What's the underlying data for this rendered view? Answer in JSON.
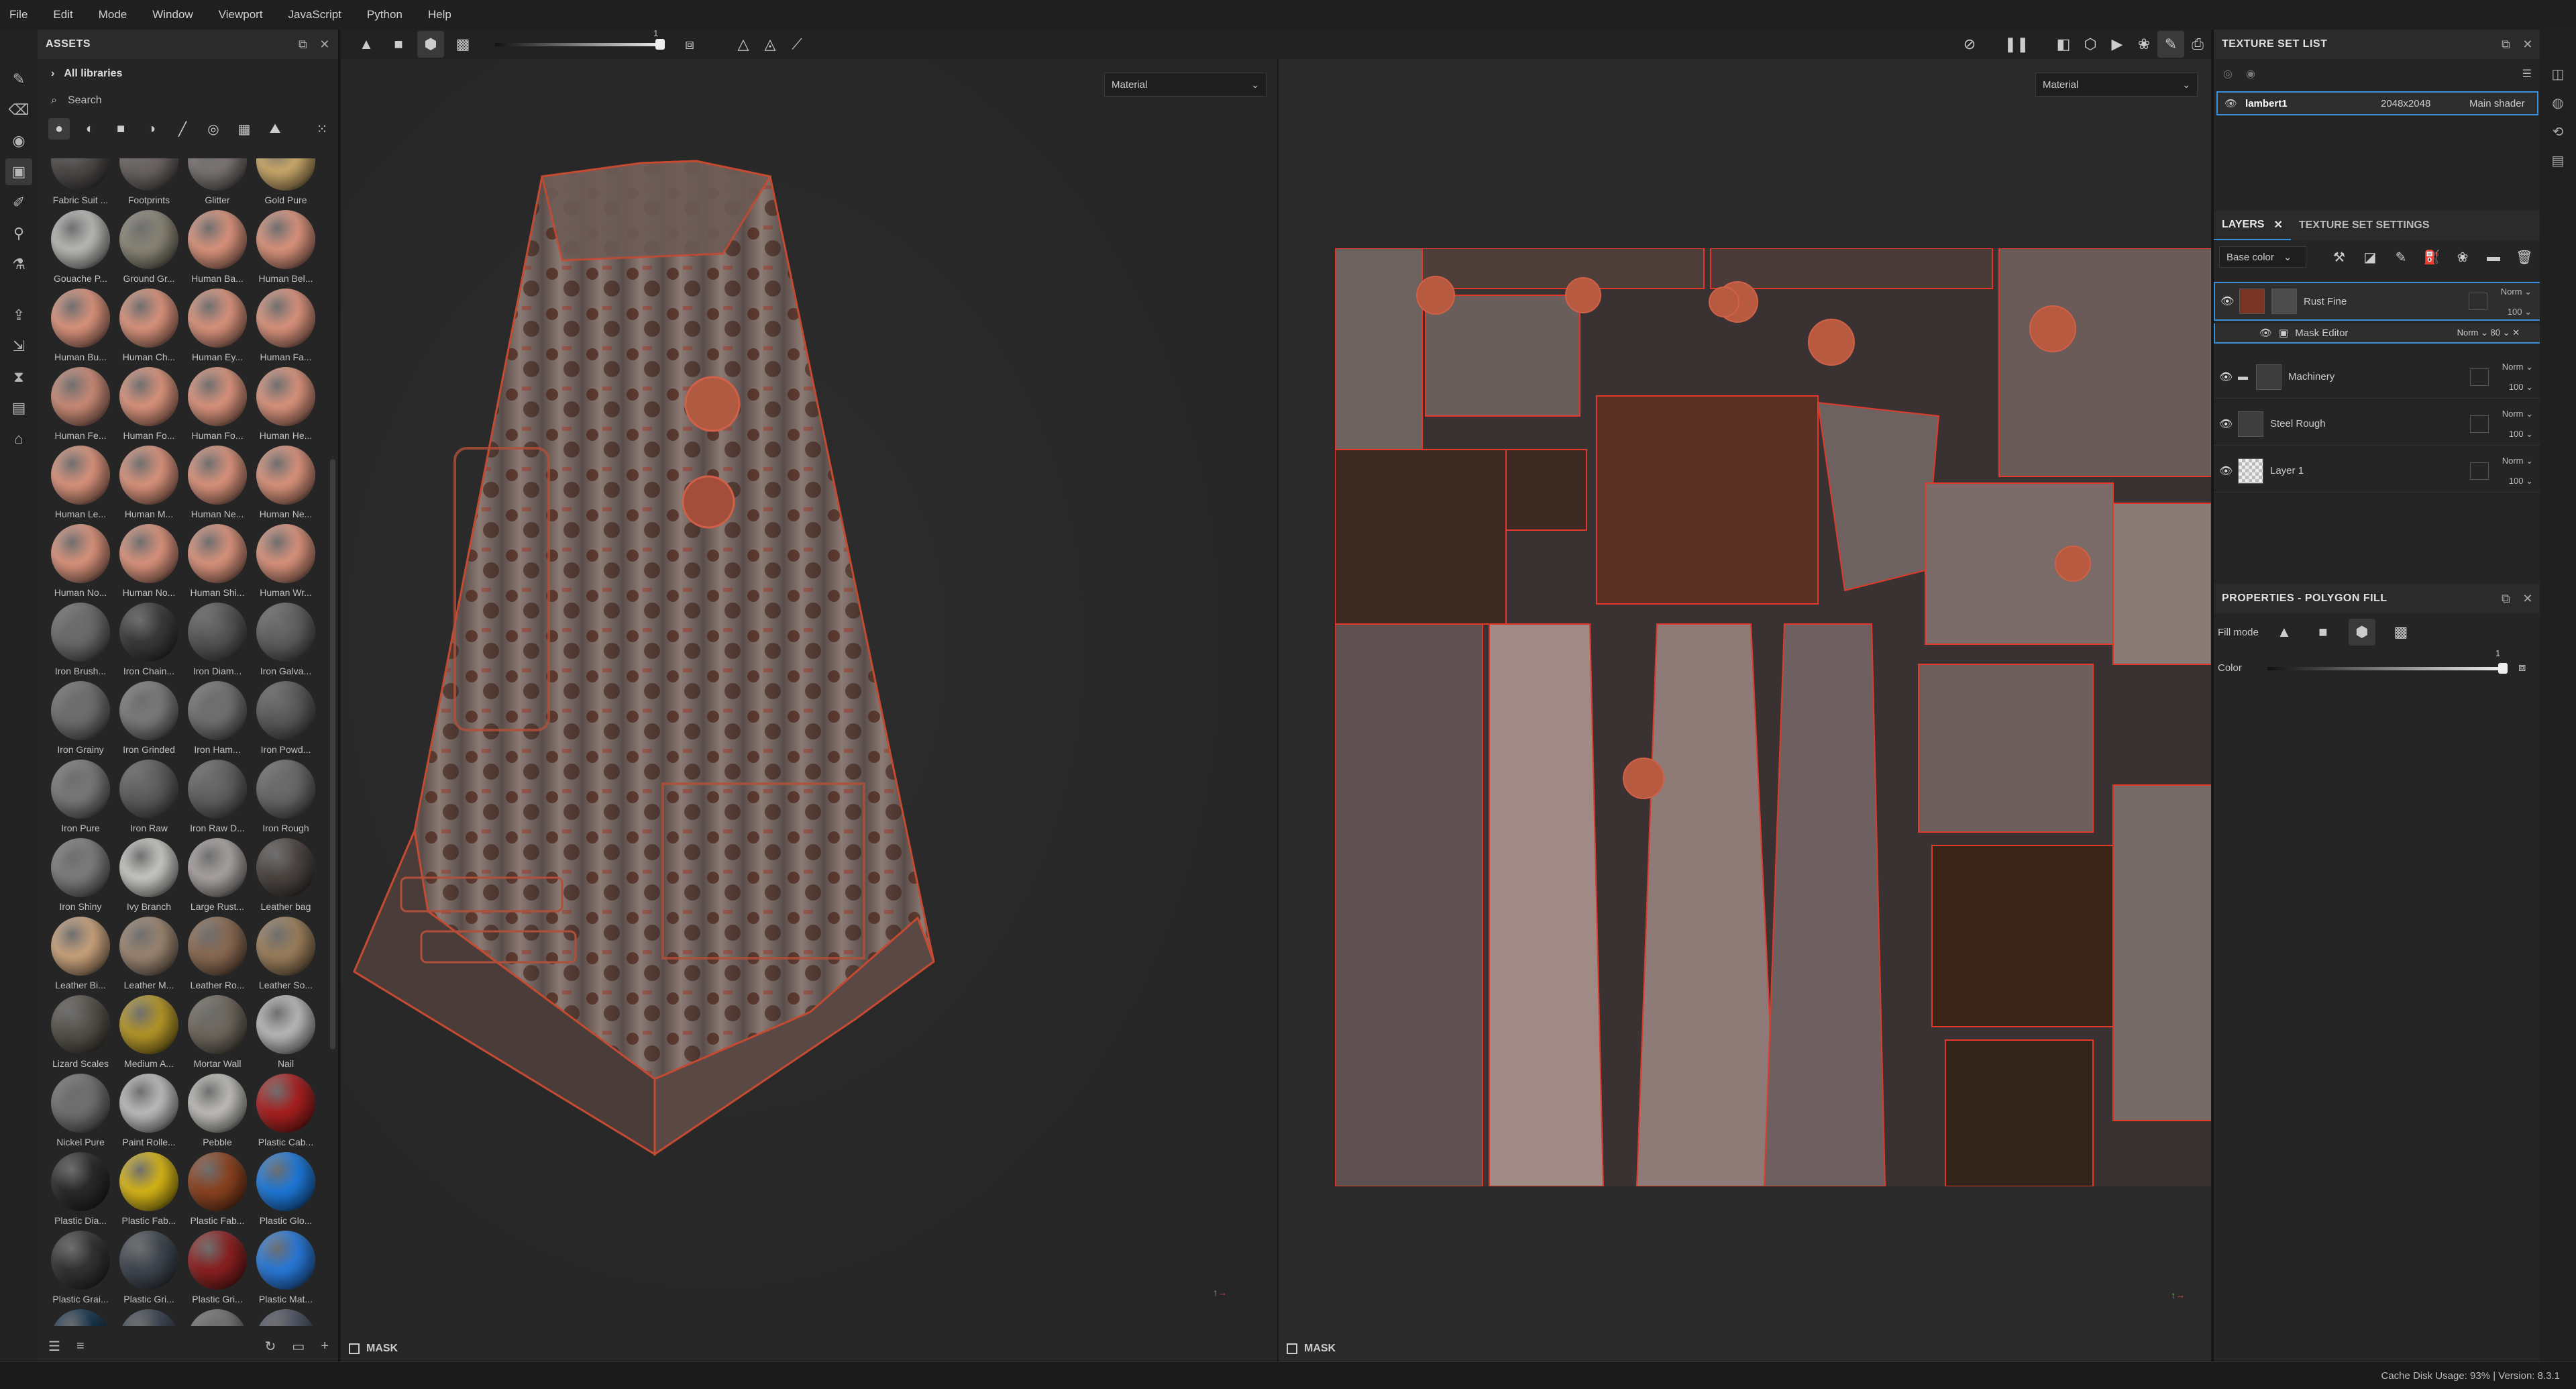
{
  "menu": [
    "File",
    "Edit",
    "Mode",
    "Window",
    "Viewport",
    "JavaScript",
    "Python",
    "Help"
  ],
  "assets": {
    "title": "ASSETS",
    "library": "All libraries",
    "search_placeholder": "Search",
    "items": [
      {
        "label": "Fabric Suit ...",
        "color": "#4d4a48"
      },
      {
        "label": "Footprints",
        "color": "#6a6462"
      },
      {
        "label": "Glitter",
        "color": "#7a7472"
      },
      {
        "label": "Gold Pure",
        "color": "#c9a86a"
      },
      {
        "label": "Gouache P...",
        "color": "#b8b8b5"
      },
      {
        "label": "Ground Gr...",
        "color": "#8a8576"
      },
      {
        "label": "Human Ba...",
        "color": "#d9937c"
      },
      {
        "label": "Human Bel...",
        "color": "#d9937c"
      },
      {
        "label": "Human Bu...",
        "color": "#d9937c"
      },
      {
        "label": "Human Ch...",
        "color": "#d9937c"
      },
      {
        "label": "Human Ey...",
        "color": "#d9937c"
      },
      {
        "label": "Human Fa...",
        "color": "#d9937c"
      },
      {
        "label": "Human Fe...",
        "color": "#c98a76"
      },
      {
        "label": "Human Fo...",
        "color": "#d9937c"
      },
      {
        "label": "Human Fo...",
        "color": "#d9937c"
      },
      {
        "label": "Human He...",
        "color": "#d9937c"
      },
      {
        "label": "Human Le...",
        "color": "#d9937c"
      },
      {
        "label": "Human M...",
        "color": "#d9937c"
      },
      {
        "label": "Human Ne...",
        "color": "#d9937c"
      },
      {
        "label": "Human Ne...",
        "color": "#d9937c"
      },
      {
        "label": "Human No...",
        "color": "#d9937c"
      },
      {
        "label": "Human No...",
        "color": "#d9937c"
      },
      {
        "label": "Human Shi...",
        "color": "#d9937c"
      },
      {
        "label": "Human Wr...",
        "color": "#d9937c"
      },
      {
        "label": "Iron Brush...",
        "color": "#6a6a6a"
      },
      {
        "label": "Iron Chain...",
        "color": "#3a3a3a"
      },
      {
        "label": "Iron Diam...",
        "color": "#555555"
      },
      {
        "label": "Iron Galva...",
        "color": "#5f5f5f"
      },
      {
        "label": "Iron Grainy",
        "color": "#6e6e6e"
      },
      {
        "label": "Iron Grinded",
        "color": "#7a7a7a"
      },
      {
        "label": "Iron Ham...",
        "color": "#707070"
      },
      {
        "label": "Iron Powd...",
        "color": "#5a5a5a"
      },
      {
        "label": "Iron Pure",
        "color": "#787878"
      },
      {
        "label": "Iron Raw",
        "color": "#5c5c5c"
      },
      {
        "label": "Iron Raw D...",
        "color": "#606060"
      },
      {
        "label": "Iron Rough",
        "color": "#676767"
      },
      {
        "label": "Iron Shiny",
        "color": "#7c7c7c"
      },
      {
        "label": "Ivy Branch",
        "color": "#c7c7c3"
      },
      {
        "label": "Large Rust...",
        "color": "#a8a2a0"
      },
      {
        "label": "Leather bag",
        "color": "#4b4440"
      },
      {
        "label": "Leather Bi...",
        "color": "#c9a27c"
      },
      {
        "label": "Leather M...",
        "color": "#9a8470"
      },
      {
        "label": "Leather Ro...",
        "color": "#8a6a52"
      },
      {
        "label": "Leather So...",
        "color": "#9a7e5a"
      },
      {
        "label": "Lizard Scales",
        "color": "#555048"
      },
      {
        "label": "Medium A...",
        "color": "#b39528"
      },
      {
        "label": "Mortar Wall",
        "color": "#6e675c"
      },
      {
        "label": "Nail",
        "color": "#b8b8b8"
      },
      {
        "label": "Nickel Pure",
        "color": "#707070"
      },
      {
        "label": "Paint Rolle...",
        "color": "#bcbcbc"
      },
      {
        "label": "Pebble",
        "color": "#bfbdb8"
      },
      {
        "label": "Plastic Cab...",
        "color": "#a82020"
      },
      {
        "label": "Plastic Dia...",
        "color": "#2a2a2a"
      },
      {
        "label": "Plastic Fab...",
        "color": "#d4b418"
      },
      {
        "label": "Plastic Fab...",
        "color": "#8a4220"
      },
      {
        "label": "Plastic Glo...",
        "color": "#1e78d8"
      },
      {
        "label": "Plastic Grai...",
        "color": "#333333"
      },
      {
        "label": "Plastic Gri...",
        "color": "#3f4650"
      },
      {
        "label": "Plastic Gri...",
        "color": "#8a2020"
      },
      {
        "label": "Plastic Mat...",
        "color": "#2878d8"
      },
      {
        "label": "",
        "color": "#14324a"
      },
      {
        "label": "",
        "color": "#3a4250"
      },
      {
        "label": "",
        "color": "#707070"
      },
      {
        "label": "",
        "color": "#4a5060"
      }
    ]
  },
  "toolbar": {
    "slider_value": "1"
  },
  "viewport3d": {
    "material_select": "Material",
    "mask_label": "MASK"
  },
  "viewport2d": {
    "material_select": "Material",
    "mask_label": "MASK"
  },
  "texture_set_list": {
    "title": "TEXTURE SET LIST",
    "row": {
      "name": "lambert1",
      "size": "2048x2048",
      "shader": "Main shader"
    }
  },
  "layers_panel": {
    "tab_layers": "LAYERS",
    "tab_settings": "TEXTURE SET SETTINGS",
    "channel": "Base color",
    "layers": [
      {
        "name": "Rust Fine",
        "blend": "Norm",
        "opacity": "100"
      },
      {
        "name": "Mask Editor",
        "blend": "Norm",
        "opacity": "80"
      },
      {
        "name": "Machinery",
        "blend": "Norm",
        "opacity": "100"
      },
      {
        "name": "Steel Rough",
        "blend": "Norm",
        "opacity": "100"
      },
      {
        "name": "Layer 1",
        "blend": "Norm",
        "opacity": "100"
      }
    ]
  },
  "properties": {
    "title": "PROPERTIES - POLYGON FILL",
    "fill_mode_label": "Fill mode",
    "color_label": "Color",
    "color_value": "1"
  },
  "status": {
    "text": "Cache Disk Usage:    93% | Version: 8.3.1"
  },
  "colors": {
    "accent": "#3b8ed8",
    "rust": "#a6452f",
    "uv_edge": "#e23a2a"
  }
}
